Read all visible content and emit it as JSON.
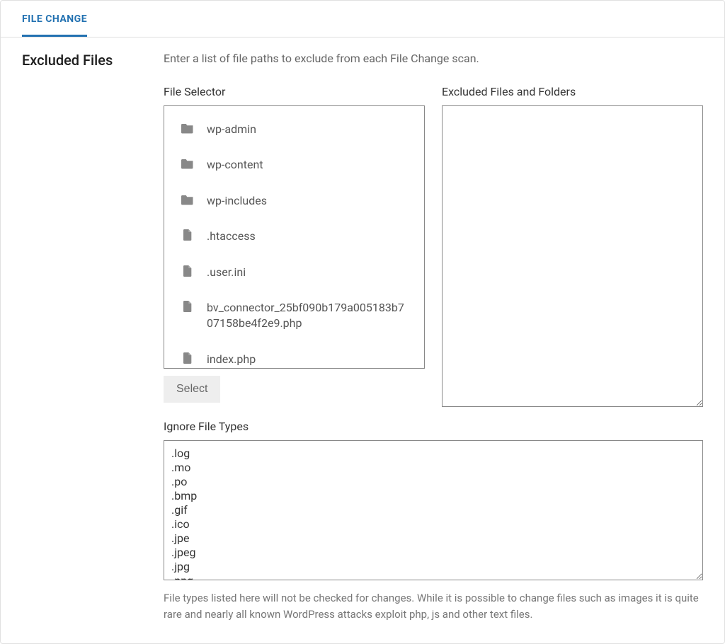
{
  "tab": {
    "label": "FILE CHANGE"
  },
  "section": {
    "title": "Excluded Files",
    "description": "Enter a list of file paths to exclude from each File Change scan."
  },
  "file_selector": {
    "label": "File Selector",
    "items": [
      {
        "type": "folder",
        "name": "wp-admin"
      },
      {
        "type": "folder",
        "name": "wp-content"
      },
      {
        "type": "folder",
        "name": "wp-includes"
      },
      {
        "type": "file",
        "name": ".htaccess"
      },
      {
        "type": "file",
        "name": ".user.ini"
      },
      {
        "type": "file",
        "name": "bv_connector_25bf090b179a005183b707158be4f2e9.php"
      },
      {
        "type": "file",
        "name": "index.php"
      }
    ],
    "select_button": "Select"
  },
  "excluded": {
    "label": "Excluded Files and Folders",
    "value": ""
  },
  "ignore": {
    "label": "Ignore File Types",
    "value": ".log\n.mo\n.po\n.bmp\n.gif\n.ico\n.jpe\n.jpeg\n.jpg\n.png",
    "help": "File types listed here will not be checked for changes. While it is possible to change files such as images it is quite rare and nearly all known WordPress attacks exploit php, js and other text files."
  }
}
